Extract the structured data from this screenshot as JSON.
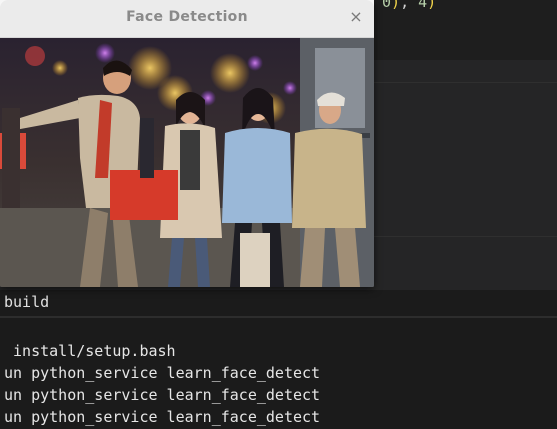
{
  "editor": {
    "code_tail_num": "0",
    "code_tail_paren": ")",
    "code_tail_sep": ", ",
    "code_tail_num2": "4",
    "code_tail_close": ")"
  },
  "dialog": {
    "title": "Face Detection",
    "close_glyph": "×",
    "image_icon": "photo-of-people-shopping"
  },
  "build_bar": {
    "text": " build"
  },
  "terminal": {
    "lines": [
      " install/setup.bash",
      "un python_service learn_face_detect",
      "un python_service learn_face_detect",
      "un python_service learn_face_detect"
    ]
  }
}
